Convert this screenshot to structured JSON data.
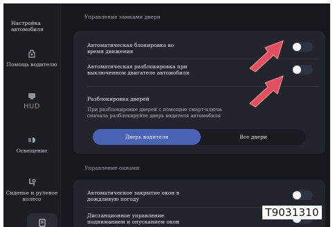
{
  "sidebar": {
    "items": [
      {
        "label": "Настройка автомобиля",
        "icon": "car-settings-icon"
      },
      {
        "label": "Помощь водителю",
        "icon": "driver-assist-icon"
      },
      {
        "label": "HUD",
        "icon": "hud-icon"
      },
      {
        "label": "Освещение",
        "icon": "lighting-icon"
      },
      {
        "label": "Сиденье и рулевое колесо",
        "icon": "seat-steering-icon"
      },
      {
        "label": "",
        "icon": "document-icon"
      }
    ]
  },
  "door_locks": {
    "title": "Управление замками двери",
    "auto_lock": {
      "label": "Автоматическая блокировка во время движения",
      "state": "on"
    },
    "auto_unlock": {
      "label": "Автоматическая разблокировка при выключенном двигателе автомобиля",
      "state": "on"
    },
    "unlock_doors": {
      "label": "Разблокировка дверей",
      "description": "При разблокировке дверей с помощью смарт-ключа сначала разблокируйте дверь водителя автомобиля",
      "options": [
        "Дверь водителя",
        "Все двери"
      ],
      "selected": "Дверь водителя"
    }
  },
  "windows": {
    "title": "Управление окнами",
    "auto_close_rain": {
      "label": "Автоматическое закрытие окон в дождливую погоду",
      "state": "on"
    },
    "remote_control": {
      "label": "Дистанционное управление подниманием и опусканием окон",
      "state": "on"
    }
  },
  "figure_code": "T9031310",
  "colors": {
    "background": "#16181d",
    "card": "#22252c",
    "accent": "#4b63b5",
    "arrow": "#e0505e",
    "toggle_track": "#2f3445"
  }
}
